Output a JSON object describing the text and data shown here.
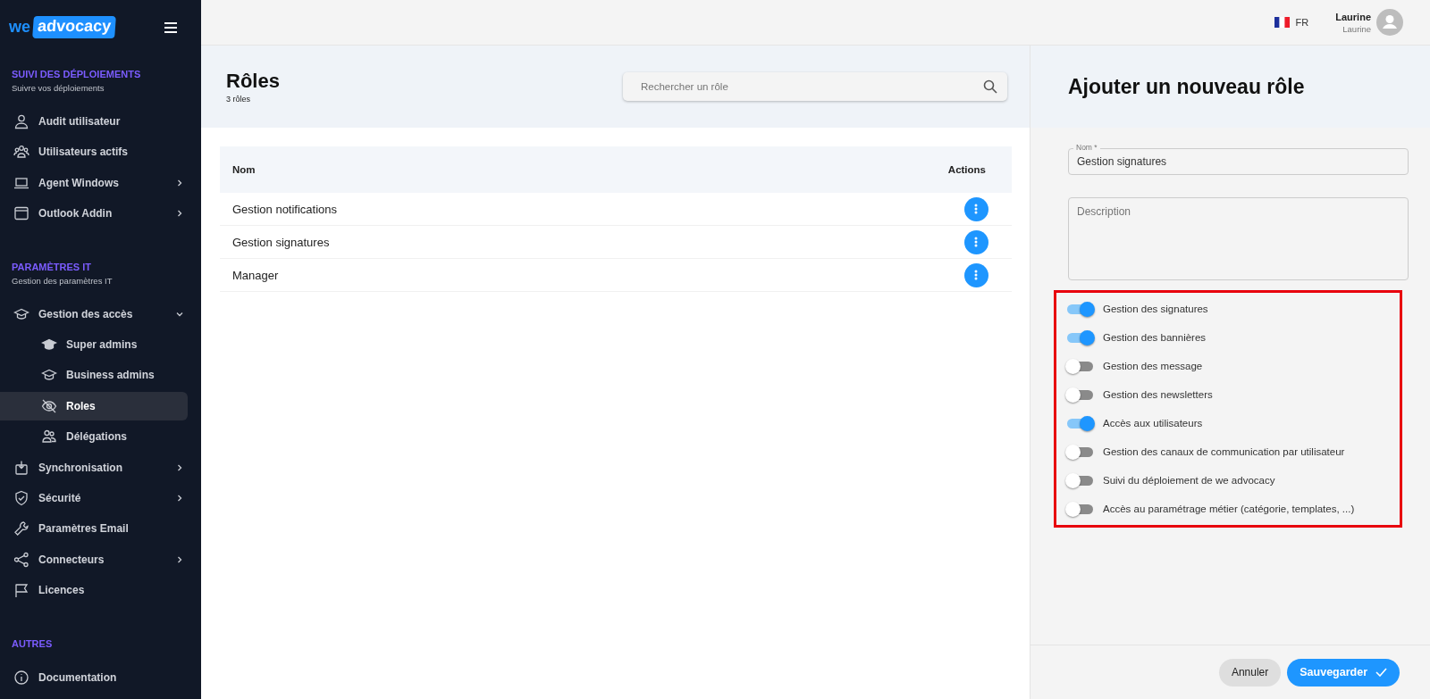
{
  "logo": {
    "left": "we",
    "right": "advocacy"
  },
  "sidebar": {
    "sections": [
      {
        "title": "SUIVI DES DÉPLOIEMENTS",
        "subtitle": "Suivre vos déploiements",
        "items": [
          {
            "label": "Audit utilisateur",
            "selected": false
          },
          {
            "label": "Utilisateurs actifs",
            "selected": false
          },
          {
            "label": "Agent Windows",
            "selected": false,
            "expanded": false
          },
          {
            "label": "Outlook Addin",
            "selected": false,
            "expanded": false
          }
        ]
      },
      {
        "title": "PARAMÈTRES IT",
        "subtitle": "Gestion des paramètres IT",
        "items": [
          {
            "label": "Gestion des accès",
            "selected": false,
            "expanded": true,
            "children": [
              {
                "label": "Super admins",
                "selected": false
              },
              {
                "label": "Business admins",
                "selected": false
              },
              {
                "label": "Roles",
                "selected": true
              },
              {
                "label": "Délégations",
                "selected": false
              }
            ]
          },
          {
            "label": "Synchronisation",
            "selected": false,
            "expanded": false
          },
          {
            "label": "Sécurité",
            "selected": false,
            "expanded": false
          },
          {
            "label": "Paramètres Email",
            "selected": false
          },
          {
            "label": "Connecteurs",
            "selected": false,
            "expanded": false
          },
          {
            "label": "Licences",
            "selected": false
          }
        ]
      },
      {
        "title": "AUTRES",
        "items": [
          {
            "label": "Documentation",
            "selected": false
          }
        ]
      }
    ]
  },
  "topbar": {
    "language": "FR",
    "user": {
      "name": "Laurine",
      "role": "Laurine"
    }
  },
  "roles": {
    "title": "Rôles",
    "count": "3 rôles",
    "search": {
      "placeholder": "Rechercher un rôle"
    },
    "table": {
      "columns": [
        "Nom",
        "Actions"
      ],
      "rows": [
        {
          "name": "Gestion notifications"
        },
        {
          "name": "Gestion signatures"
        },
        {
          "name": "Manager"
        }
      ]
    }
  },
  "form": {
    "title": "Ajouter un nouveau rôle",
    "name_field": {
      "label": "Nom *",
      "value": "Gestion signatures"
    },
    "description_field": {
      "placeholder": "Description"
    },
    "permissions": [
      {
        "label": "Gestion des signatures",
        "on": true
      },
      {
        "label": "Gestion des bannières",
        "on": true
      },
      {
        "label": "Gestion des message",
        "on": false
      },
      {
        "label": "Gestion des newsletters",
        "on": false
      },
      {
        "label": "Accès aux utilisateurs",
        "on": true
      },
      {
        "label": "Gestion des canaux de communication par utilisateur",
        "on": false
      },
      {
        "label": "Suivi du déploiement de we advocacy",
        "on": false
      },
      {
        "label": "Accès au paramétrage métier (catégorie, templates, ...)",
        "on": false
      }
    ],
    "buttons": {
      "cancel": "Annuler",
      "save": "Sauvegarder"
    }
  }
}
